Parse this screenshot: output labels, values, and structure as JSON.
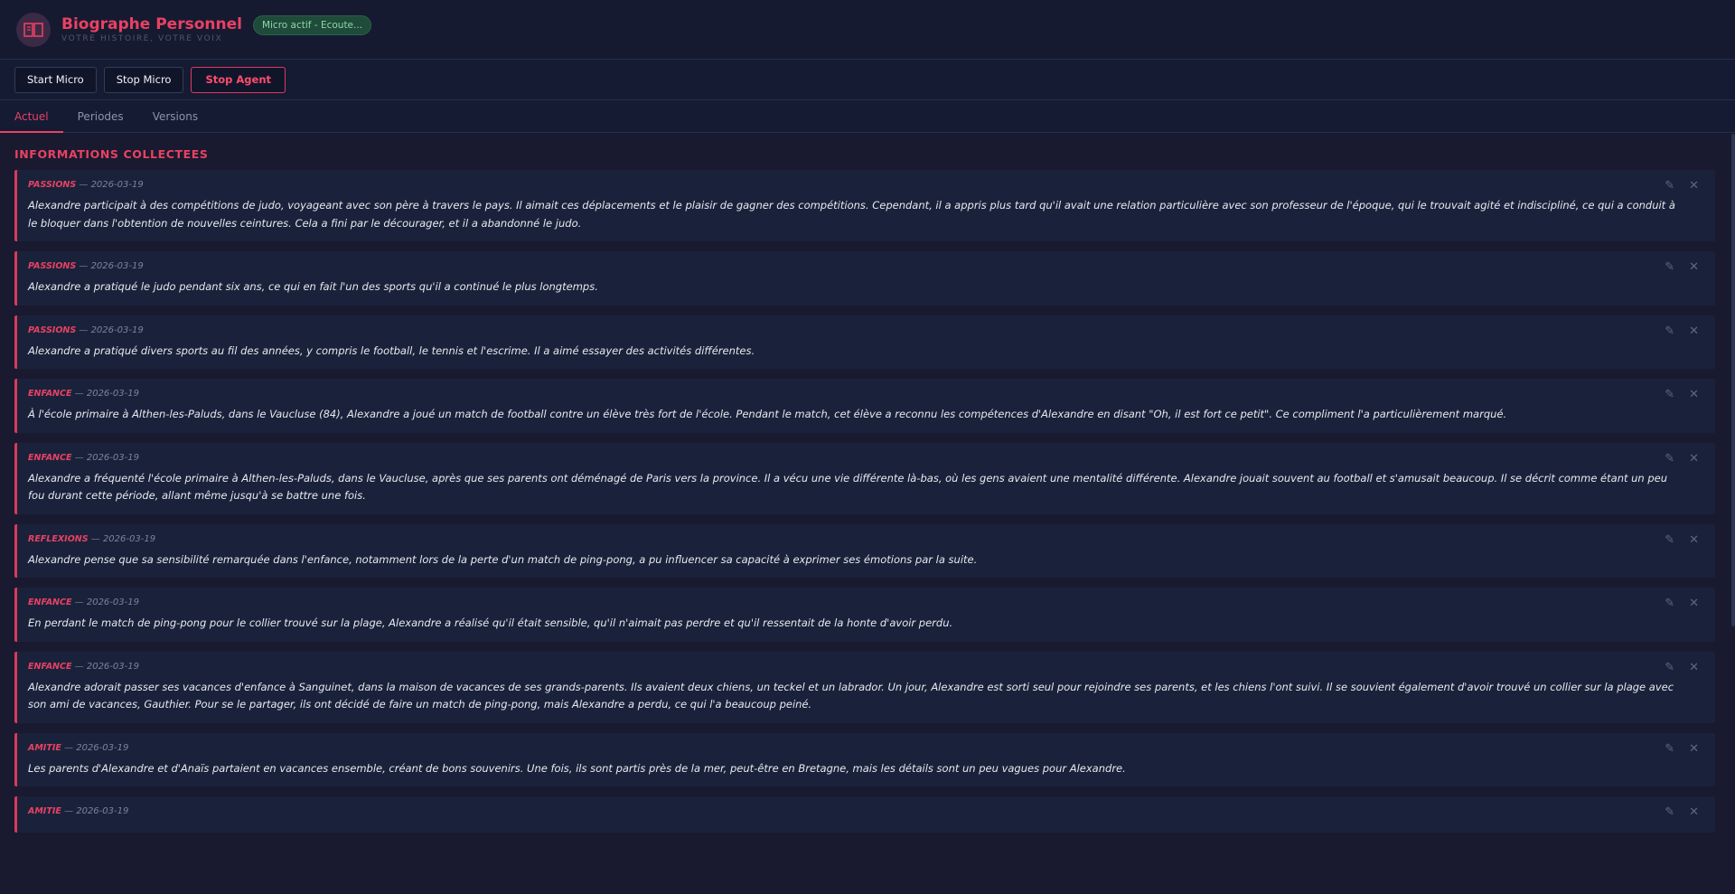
{
  "header": {
    "title": "Biographe Personnel",
    "subtitle": "VOTRE HISTOIRE, VOTRE VOIX",
    "status": "Micro actif - Ecoute...",
    "logo_icon": "book-icon"
  },
  "toolbar": {
    "start_micro": "Start Micro",
    "stop_micro": "Stop Micro",
    "stop_agent": "Stop Agent"
  },
  "tabs": [
    {
      "label": "Actuel",
      "active": true
    },
    {
      "label": "Periodes",
      "active": false
    },
    {
      "label": "Versions",
      "active": false
    }
  ],
  "main": {
    "section_title": "INFORMATIONS COLLECTEES",
    "entries": [
      {
        "category": "PASSIONS",
        "sep": " — ",
        "date": "2026-03-19",
        "text": "Alexandre participait à des compétitions de judo, voyageant avec son père à travers le pays. Il aimait ces déplacements et le plaisir de gagner des compétitions. Cependant, il a appris plus tard qu'il avait une relation particulière avec son professeur de l'époque, qui le trouvait agité et indiscipliné, ce qui a conduit à le bloquer dans l'obtention de nouvelles ceintures. Cela a fini par le décourager, et il a abandonné le judo."
      },
      {
        "category": "PASSIONS",
        "sep": " — ",
        "date": "2026-03-19",
        "text": "Alexandre a pratiqué le judo pendant six ans, ce qui en fait l'un des sports qu'il a continué le plus longtemps."
      },
      {
        "category": "PASSIONS",
        "sep": " — ",
        "date": "2026-03-19",
        "text": "Alexandre a pratiqué divers sports au fil des années, y compris le football, le tennis et l'escrime. Il a aimé essayer des activités différentes."
      },
      {
        "category": "ENFANCE",
        "sep": " — ",
        "date": "2026-03-19",
        "text": "À l'école primaire à Althen-les-Paluds, dans le Vaucluse (84), Alexandre a joué un match de football contre un élève très fort de l'école. Pendant le match, cet élève a reconnu les compétences d'Alexandre en disant \"Oh, il est fort ce petit\". Ce compliment l'a particulièrement marqué."
      },
      {
        "category": "ENFANCE",
        "sep": " — ",
        "date": "2026-03-19",
        "text": "Alexandre a fréquenté l'école primaire à Althen-les-Paluds, dans le Vaucluse, après que ses parents ont déménagé de Paris vers la province. Il a vécu une vie différente là-bas, où les gens avaient une mentalité différente. Alexandre jouait souvent au football et s'amusait beaucoup. Il se décrit comme étant un peu fou durant cette période, allant même jusqu'à se battre une fois."
      },
      {
        "category": "REFLEXIONS",
        "sep": " — ",
        "date": "2026-03-19",
        "text": "Alexandre pense que sa sensibilité remarquée dans l'enfance, notamment lors de la perte d'un match de ping-pong, a pu influencer sa capacité à exprimer ses émotions par la suite."
      },
      {
        "category": "ENFANCE",
        "sep": " — ",
        "date": "2026-03-19",
        "text": "En perdant le match de ping-pong pour le collier trouvé sur la plage, Alexandre a réalisé qu'il était sensible, qu'il n'aimait pas perdre et qu'il ressentait de la honte d'avoir perdu."
      },
      {
        "category": "ENFANCE",
        "sep": " — ",
        "date": "2026-03-19",
        "text": "Alexandre adorait passer ses vacances d'enfance à Sanguinet, dans la maison de vacances de ses grands-parents. Ils avaient deux chiens, un teckel et un labrador. Un jour, Alexandre est sorti seul pour rejoindre ses parents, et les chiens l'ont suivi. Il se souvient également d'avoir trouvé un collier sur la plage avec son ami de vacances, Gauthier. Pour se le partager, ils ont décidé de faire un match de ping-pong, mais Alexandre a perdu, ce qui l'a beaucoup peiné."
      },
      {
        "category": "AMITIE",
        "sep": " — ",
        "date": "2026-03-19",
        "text": "Les parents d'Alexandre et d'Anaïs partaient en vacances ensemble, créant de bons souvenirs. Une fois, ils sont partis près de la mer, peut-être en Bretagne, mais les détails sont un peu vagues pour Alexandre."
      },
      {
        "category": "AMITIE",
        "sep": " — ",
        "date": "2026-03-19",
        "text": ""
      }
    ],
    "edit_icon": "✎",
    "delete_icon": "✕"
  }
}
